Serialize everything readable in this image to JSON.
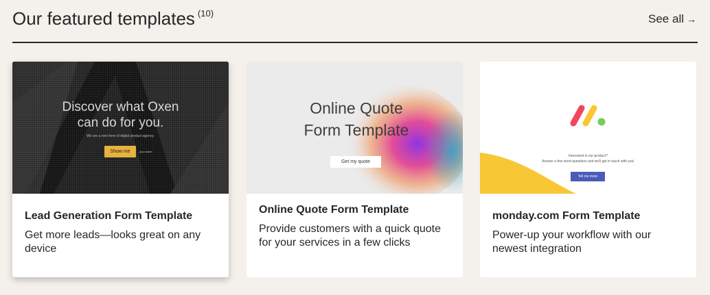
{
  "header": {
    "title": "Our featured templates",
    "count": "(10)",
    "see_all": "See all",
    "see_all_arrow": "→"
  },
  "cards": [
    {
      "title": "Lead Generation Form Template",
      "description": "Get more leads—looks great on any device",
      "preview": {
        "headline_line1": "Discover what Oxen",
        "headline_line2": "can do for you.",
        "subtext": "We are a new form of digital product agency.",
        "button": "Show me",
        "small_text": "your.name"
      }
    },
    {
      "title": "Online Quote Form Template",
      "description": "Provide customers with a quick quote for your services in a few clicks",
      "preview": {
        "headline_line1": "Online Quote",
        "headline_line2": "Form Template",
        "button": "Get my quote"
      }
    },
    {
      "title": "monday.com Form Template",
      "description": "Power-up your workflow with our newest integration",
      "preview": {
        "logo_icon": "monday-logo-icon",
        "line1": "Interested in our product?",
        "line2": "Answer a few short questions and we'll get in touch with you!",
        "button": "Tell me more"
      }
    }
  ],
  "colors": {
    "background": "#f4f0eb",
    "text": "#262627",
    "card_bg": "#ffffff",
    "oxen_button": "#e8b33c",
    "monday_button": "#4a5bb8",
    "monday_red": "#f0475c",
    "monday_yellow": "#f9c733",
    "monday_green": "#74cd59"
  }
}
